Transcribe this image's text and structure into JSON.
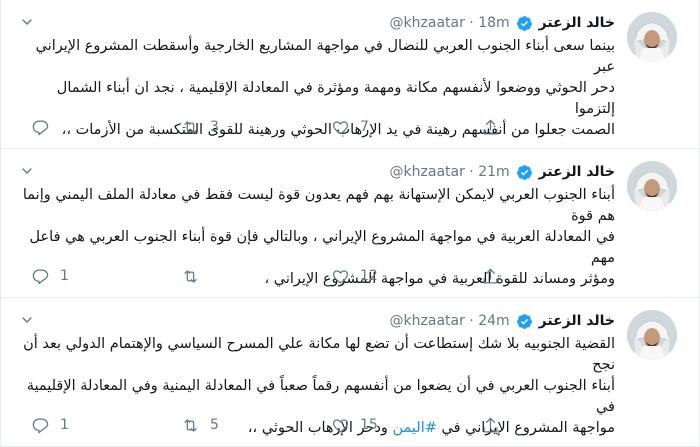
{
  "tweets": [
    {
      "name": "خالد الزعتر",
      "handle": "@khzaatar",
      "time": "18m",
      "text_lines": [
        "بينما سعى أبناء الجنوب العربي للنضال في مواجهة المشاريع الخارجية وأسقطت المشروع الإيراني عبر",
        "دحر الحوثي ووضعوا لأنفسهم مكانة ومهمة ومؤثرة في المعادلة الإقليمية ، نجد ان أبناء الشمال إلتزموا",
        "الصمت جعلوا من أنفسهم رهينة في يد الإرهاب الحوثي ورهينة للقوى المتكسبة من الأزمات ،،"
      ],
      "replies": "",
      "retweets": "3",
      "likes": "7"
    },
    {
      "name": "خالد الزعتر",
      "handle": "@khzaatar",
      "time": "21m",
      "text_lines": [
        "أبناء الجنوب العربي لايمكن الإستهانة بهم فهم يعدون قوة ليست فقط في معادلة الملف اليمني وإنما هم قوة",
        "في المعادلة العربية في مواجهة المشروع الإيراني ، وبالتالي فإن قوة أبناء الجنوب العربي هي فاعل مهم",
        "ومؤثر ومساند للقوة العربية في مواجهة المشروع الإيراني ،"
      ],
      "replies": "1",
      "retweets": "",
      "likes": "12"
    },
    {
      "name": "خالد الزعتر",
      "handle": "@khzaatar",
      "time": "24m",
      "text_lines": [
        "القضية الجنوبيه بلا شك إستطاعت أن تضع لها مكانة علي المسرح السياسي والإهتمام الدولي بعد أن نجح",
        "أبناء الجنوب العربي في أن يضعوا من أنفسهم رقماً صعباً في المعادلة اليمنية وفي المعادلة الإقليمية في"
      ],
      "last_line_prefix": "مواجهة المشروع الإيراني في ",
      "last_line_hashtag": "#اليمن",
      "last_line_suffix": " ودحر الإرهاب الحوثي ،،",
      "replies": "1",
      "retweets": "5",
      "likes": "15"
    }
  ],
  "colors": {
    "verified": "#1da1f2",
    "hashtag": "#1b95e0",
    "muted": "#657786"
  },
  "icons": {
    "reply": "reply-icon",
    "retweet": "retweet-icon",
    "like": "heart-icon",
    "share": "share-icon",
    "caret": "chevron-down-icon",
    "verified": "verified-badge-icon"
  }
}
